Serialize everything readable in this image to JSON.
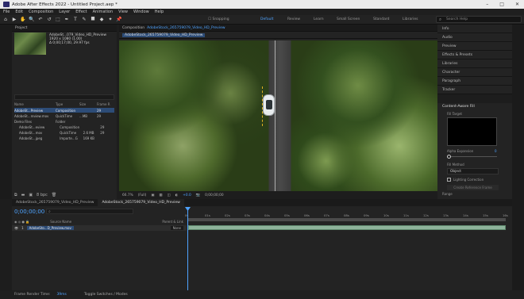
{
  "app": {
    "window_title": "Adobe After Effects 2022 - Untitled Project.aep *",
    "win_buttons": [
      "–",
      "□",
      "✕"
    ]
  },
  "menu": [
    "File",
    "Edit",
    "Composition",
    "Layer",
    "Effect",
    "Animation",
    "View",
    "Window",
    "Help"
  ],
  "toolbar": {
    "tools": [
      "⌂",
      "▶",
      "✋",
      "🔍",
      "↶",
      "↺",
      "⬚",
      "✒",
      "T",
      "✎",
      "⯀",
      "◆",
      "✦",
      "📌"
    ],
    "workspaces": [
      "Default",
      "Review",
      "Learn",
      "Small Screen",
      "Standard",
      "Libraries"
    ],
    "active_workspace": "Default",
    "search_help": "Search Help"
  },
  "project": {
    "tab": "Project",
    "item_name": "AdobeSt...079_Video_HD_Preview",
    "item_info1": "1920 x 1080 (1.00)",
    "item_info2": "Δ 0;00;17;00, 29.97 fps",
    "search_placeholder": "",
    "columns": [
      "Name",
      "Type",
      "Size",
      "Frame R"
    ],
    "rows": [
      {
        "name": "AdobeSt...Preview",
        "type": "Composition",
        "size": "",
        "fr": "29"
      },
      {
        "name": "AdobeSt...review.mov",
        "type": "QuickTime",
        "size": "...MB",
        "fr": "29"
      },
      {
        "name": "Demo Files",
        "type": "Folder",
        "size": "",
        "fr": ""
      },
      {
        "name": "AdobeSt...eview",
        "type": "Composition",
        "size": "",
        "fr": "29"
      },
      {
        "name": "AdobeSt...mov",
        "type": "QuickTime",
        "size": "2.6 MB",
        "fr": "29"
      },
      {
        "name": "AdobeSt...jpeg",
        "type": "Importe...G",
        "size": "169 KB",
        "fr": ""
      }
    ],
    "footer_bpc": "8 bpc"
  },
  "composition": {
    "tab_prefix": "Composition",
    "tab_name": "AdobeStock_265759079_Video_HD_Preview",
    "crumb": "AdobeStock_265759079_Video_HD_Preview",
    "zoom": "66.7%",
    "resolution": "(Full)",
    "exposure": "+0.0",
    "timecode": "0;00;00;00"
  },
  "right_panels": [
    "Info",
    "Audio",
    "Preview",
    "Effects & Presets",
    "Libraries",
    "Character",
    "Paragraph",
    "Tracker"
  ],
  "content_aware": {
    "title": "Content-Aware Fill",
    "fill_target_label": "Fill Target",
    "alpha_label": "Alpha Expansion",
    "alpha_value": "0",
    "fill_method_label": "Fill Method",
    "fill_method_value": "Object",
    "lighting_label": "Lighting Correction",
    "range_label": "Range",
    "create_ref_label": "Create Reference Frame"
  },
  "timeline": {
    "tabs": [
      "AdobeStock_265759079_Video_HD_Preview",
      "AdobeStock_265759079_Video_HD_Preview"
    ],
    "timecode": "0;00;00;00",
    "ticks": [
      "0s",
      "01s",
      "02s",
      "03s",
      "04s",
      "05s",
      "06s",
      "07s",
      "08s",
      "09s",
      "10s",
      "11s",
      "12s",
      "13s",
      "14s",
      "15s",
      "16s"
    ],
    "col_source": "Source Name",
    "col_parent": "Parent & Link",
    "layer_num": "1",
    "layer_name": "AdobeSto...D_Preview.mov",
    "parent_value": "None"
  },
  "footer": {
    "render_label": "Frame Render Time:",
    "render_value": "39ms",
    "toggle_label": "Toggle Switches / Modes"
  },
  "colors": {
    "accent": "#4ea3ff",
    "selection": "#2d4c77",
    "layer_bar": "#8eb39b"
  }
}
